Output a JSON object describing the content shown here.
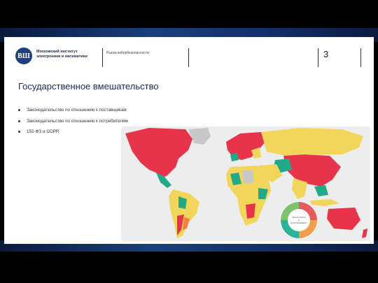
{
  "header": {
    "logo_text": "ВШ",
    "org_line1": "Московский институт",
    "org_line2": "электроники и математики",
    "course": "Рынок кибербезопасности",
    "page_number": "3"
  },
  "title": "Государственное вмешательство",
  "bullets": [
    "Законодательство по отношению к поставщикам",
    "Законодательство по отношению к потребителям",
    "152-ФЗ и GDPR"
  ],
  "map": {
    "colors": {
      "red": "#e8344a",
      "yellow": "#f2d65c",
      "teal": "#22a98a",
      "orange": "#f08246",
      "gray": "#c8c8c8",
      "ocean": "#ededed",
      "wheel_red": "#e55a5a",
      "wheel_orange": "#f0a04a",
      "wheel_teal": "#2bb39a",
      "wheel_green": "#7cc36b"
    },
    "wheel_center_text": [
      "REGULATION",
      "&",
      "ENFORCEMENT"
    ]
  }
}
